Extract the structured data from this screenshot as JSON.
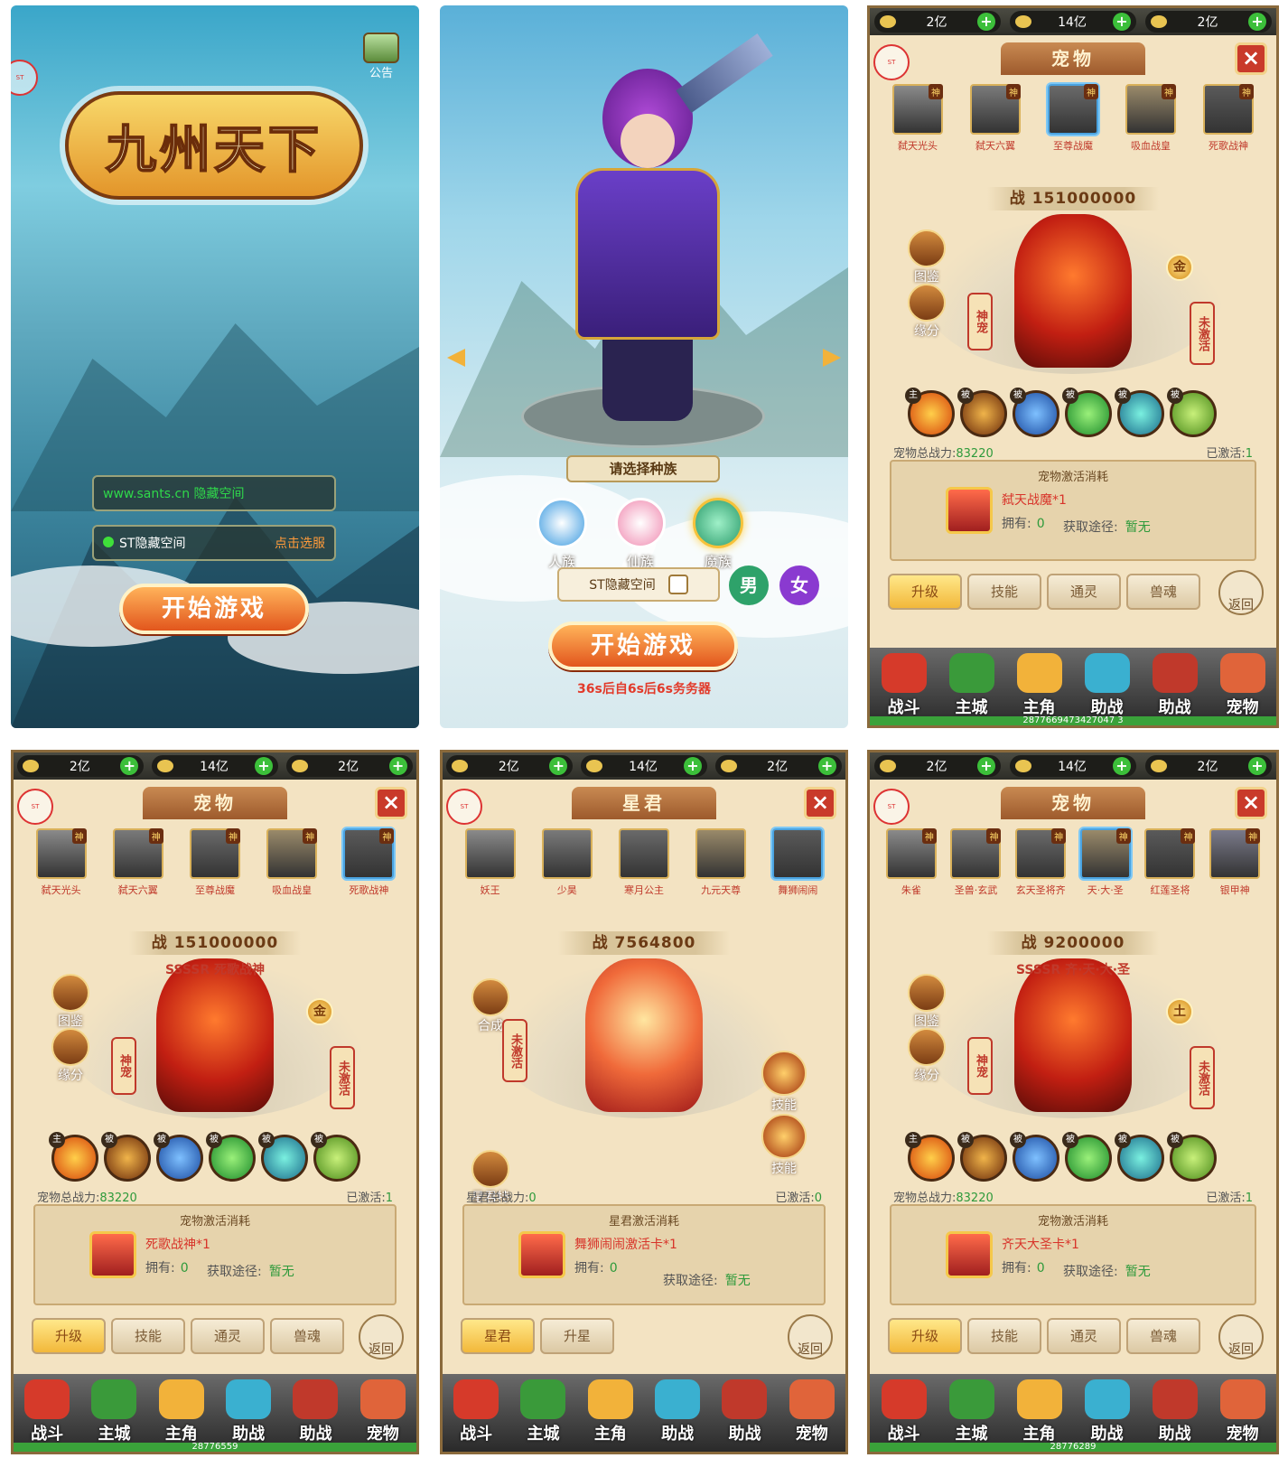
{
  "login": {
    "notice_label": "公告",
    "logo_text": "九州天下",
    "url_field": "www.sants.cn 隐藏空间",
    "server_name": "ST隐藏空间",
    "server_select": "点击选服",
    "start_label": "开始游戏"
  },
  "create": {
    "race_prompt": "请选择种族",
    "races": [
      "人族",
      "仙族",
      "魔族"
    ],
    "name_value": "ST隐藏空间",
    "gender_male": "男",
    "gender_female": "女",
    "start_label": "开始游戏",
    "countdown": "36s后自6s后6s务务器"
  },
  "currency": [
    "2亿",
    "14亿",
    "2亿"
  ],
  "nav": [
    "战斗",
    "主城",
    "主角",
    "助战",
    "助战",
    "宠物"
  ],
  "panels": [
    {
      "title": "宠物",
      "pets": [
        "弑天光头",
        "弑天六翼",
        "至尊战魔",
        "吸血战皇",
        "死歌战神"
      ],
      "selected": 2,
      "power": "战 151000000",
      "side_buttons": [
        "图鉴",
        "缘分"
      ],
      "badge_left": "神宠",
      "badge_right": "未激活",
      "element": "金",
      "stat_left": "宠物总战力:",
      "stat_left_value": "83220",
      "stat_right": "已激活:",
      "stat_right_value": "1",
      "cost_title": "宠物激活消耗",
      "card_name": "弑天战魔",
      "card_qty": "*1",
      "own_label": "拥有:",
      "own_value": "0",
      "get_label": "获取途径:",
      "get_value": "暂无",
      "tabs": [
        "升级",
        "技能",
        "通灵",
        "兽魂"
      ],
      "back": "返回",
      "uid": "2877669473427047 3"
    },
    {
      "title": "宠物",
      "pets": [
        "弑天光头",
        "弑天六翼",
        "至尊战魔",
        "吸血战皇",
        "死歌战神"
      ],
      "selected": 4,
      "power": "战 151000000",
      "rank_name": "SSSSR 死歌战神",
      "side_buttons": [
        "图鉴",
        "缘分"
      ],
      "badge_left": "神宠",
      "badge_right": "未激活",
      "element": "金",
      "stat_left": "宠物总战力:",
      "stat_left_value": "83220",
      "stat_right": "已激活:",
      "stat_right_value": "1",
      "cost_title": "宠物激活消耗",
      "card_name": "死歌战神",
      "card_qty": "*1",
      "own_label": "拥有:",
      "own_value": "0",
      "get_label": "获取途径:",
      "get_value": "暂无",
      "tabs": [
        "升级",
        "技能",
        "通灵",
        "兽魂"
      ],
      "back": "返回",
      "uid": "28776559"
    },
    {
      "title": "星君",
      "pets": [
        "妖王",
        "少昊",
        "寒月公主",
        "九元天尊",
        "舞狮闹闹"
      ],
      "selected": 4,
      "power": "战 7564800",
      "side_buttons": [
        "合成",
        "星君特技"
      ],
      "badge_left": "未激活",
      "right_skills": [
        "技能",
        "技能"
      ],
      "stat_left": "星君总战力:",
      "stat_left_value": "0",
      "stat_right": "已激活:",
      "stat_right_value": "0",
      "cost_title": "星君激活消耗",
      "card_name": "舞狮闹闹激活卡",
      "card_qty": "*1",
      "own_label": "拥有:",
      "own_value": "0",
      "get_label": "获取途径:",
      "get_value": "暂无",
      "tabs": [
        "星君",
        "升星"
      ],
      "back": "返回",
      "uid": ""
    },
    {
      "title": "宠物",
      "pets": [
        "朱雀",
        "圣兽·玄武",
        "玄天圣将齐",
        "天·大·圣",
        "红莲圣将",
        "银甲神"
      ],
      "selected": 3,
      "power": "战 9200000",
      "rank_name": "SSSSR 齐·天·大·圣",
      "side_buttons": [
        "图鉴",
        "缘分"
      ],
      "badge_left": "神宠",
      "badge_right": "未激活",
      "element": "土",
      "stat_left": "宠物总战力:",
      "stat_left_value": "83220",
      "stat_right": "已激活:",
      "stat_right_value": "1",
      "cost_title": "宠物激活消耗",
      "card_name": "齐天大圣卡",
      "card_qty": "*1",
      "own_label": "拥有:",
      "own_value": "0",
      "get_label": "获取途径:",
      "get_value": "暂无",
      "tabs": [
        "升级",
        "技能",
        "通灵",
        "兽魂"
      ],
      "back": "返回",
      "uid": "28776289"
    }
  ],
  "colors": {
    "accent": "#e2561d",
    "red": "#c0392b",
    "green": "#2e9a3b"
  }
}
